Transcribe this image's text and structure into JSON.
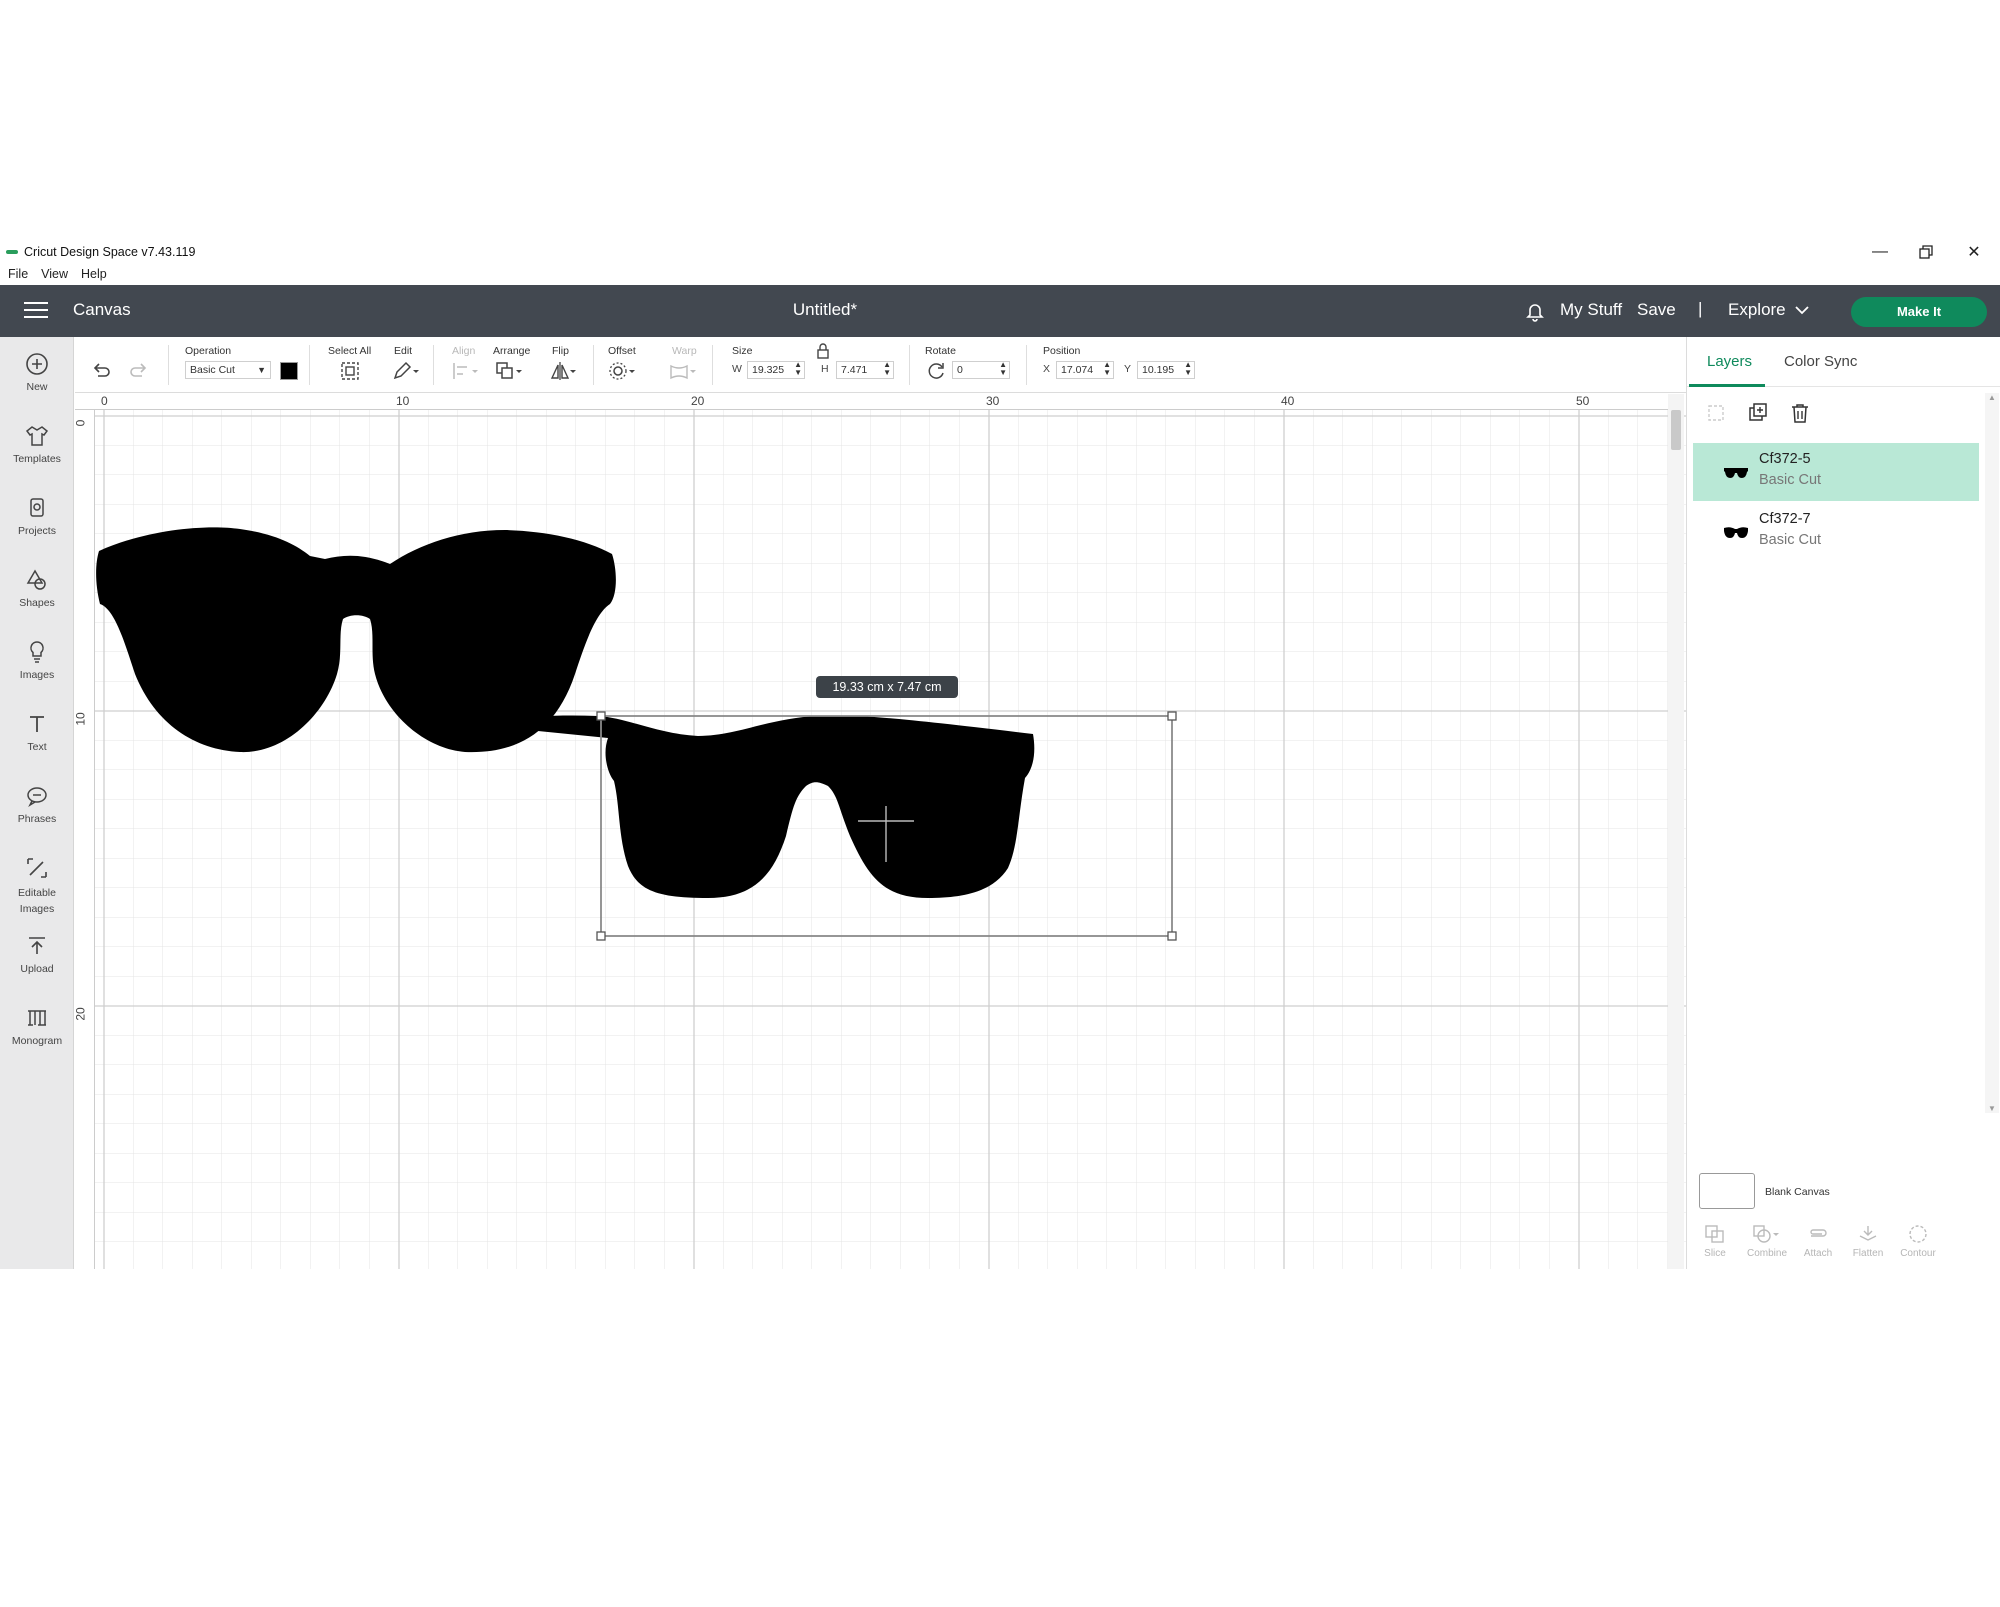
{
  "window": {
    "title": "Cricut Design Space  v7.43.119"
  },
  "menu": {
    "items": [
      "File",
      "View",
      "Help"
    ]
  },
  "header": {
    "section": "Canvas",
    "doc_title": "Untitled*",
    "my_stuff": "My Stuff",
    "save": "Save",
    "separator": "|",
    "explore": "Explore",
    "make_it": "Make It"
  },
  "sidebar": {
    "items": [
      {
        "label": "New",
        "icon": "plus-circle-icon"
      },
      {
        "label": "Templates",
        "icon": "shirt-icon"
      },
      {
        "label": "Projects",
        "icon": "projects-icon"
      },
      {
        "label": "Shapes",
        "icon": "shapes-icon"
      },
      {
        "label": "Images",
        "icon": "lightbulb-icon"
      },
      {
        "label": "Text",
        "icon": "text-icon"
      },
      {
        "label": "Phrases",
        "icon": "speech-bubble-icon"
      },
      {
        "label": "Editable Images",
        "icon": "editable-images-icon"
      },
      {
        "label": "Upload",
        "icon": "upload-icon"
      },
      {
        "label": "Monogram",
        "icon": "monogram-icon"
      }
    ]
  },
  "toolbar": {
    "operation_label": "Operation",
    "operation_value": "Basic Cut",
    "operation_color": "#000000",
    "select_all_label": "Select All",
    "edit_label": "Edit",
    "align_label": "Align",
    "arrange_label": "Arrange",
    "flip_label": "Flip",
    "offset_label": "Offset",
    "warp_label": "Warp",
    "size_label": "Size",
    "w_label": "W",
    "w_value": "19.325",
    "h_label": "H",
    "h_value": "7.471",
    "rotate_label": "Rotate",
    "rotate_value": "0",
    "position_label": "Position",
    "x_label": "X",
    "x_value": "17.074",
    "y_label": "Y",
    "y_value": "10.195"
  },
  "canvas": {
    "ruler_top": [
      "0",
      "10",
      "20",
      "30",
      "40",
      "50"
    ],
    "ruler_left": [
      "0",
      "10",
      "20"
    ],
    "size_tooltip": "19.33  cm x 7.47  cm"
  },
  "layers_panel": {
    "tabs": [
      "Layers",
      "Color Sync"
    ],
    "layers": [
      {
        "name": "Cf372-5",
        "operation": "Basic Cut",
        "selected": true
      },
      {
        "name": "Cf372-7",
        "operation": "Basic Cut",
        "selected": false
      }
    ],
    "blank_canvas": "Blank Canvas",
    "bottom_tools": [
      "Slice",
      "Combine",
      "Attach",
      "Flatten",
      "Contour"
    ]
  },
  "colors": {
    "header_bg": "#424850",
    "accent": "#0f8a5c",
    "selected_layer_bg": "#b9e8d6"
  }
}
